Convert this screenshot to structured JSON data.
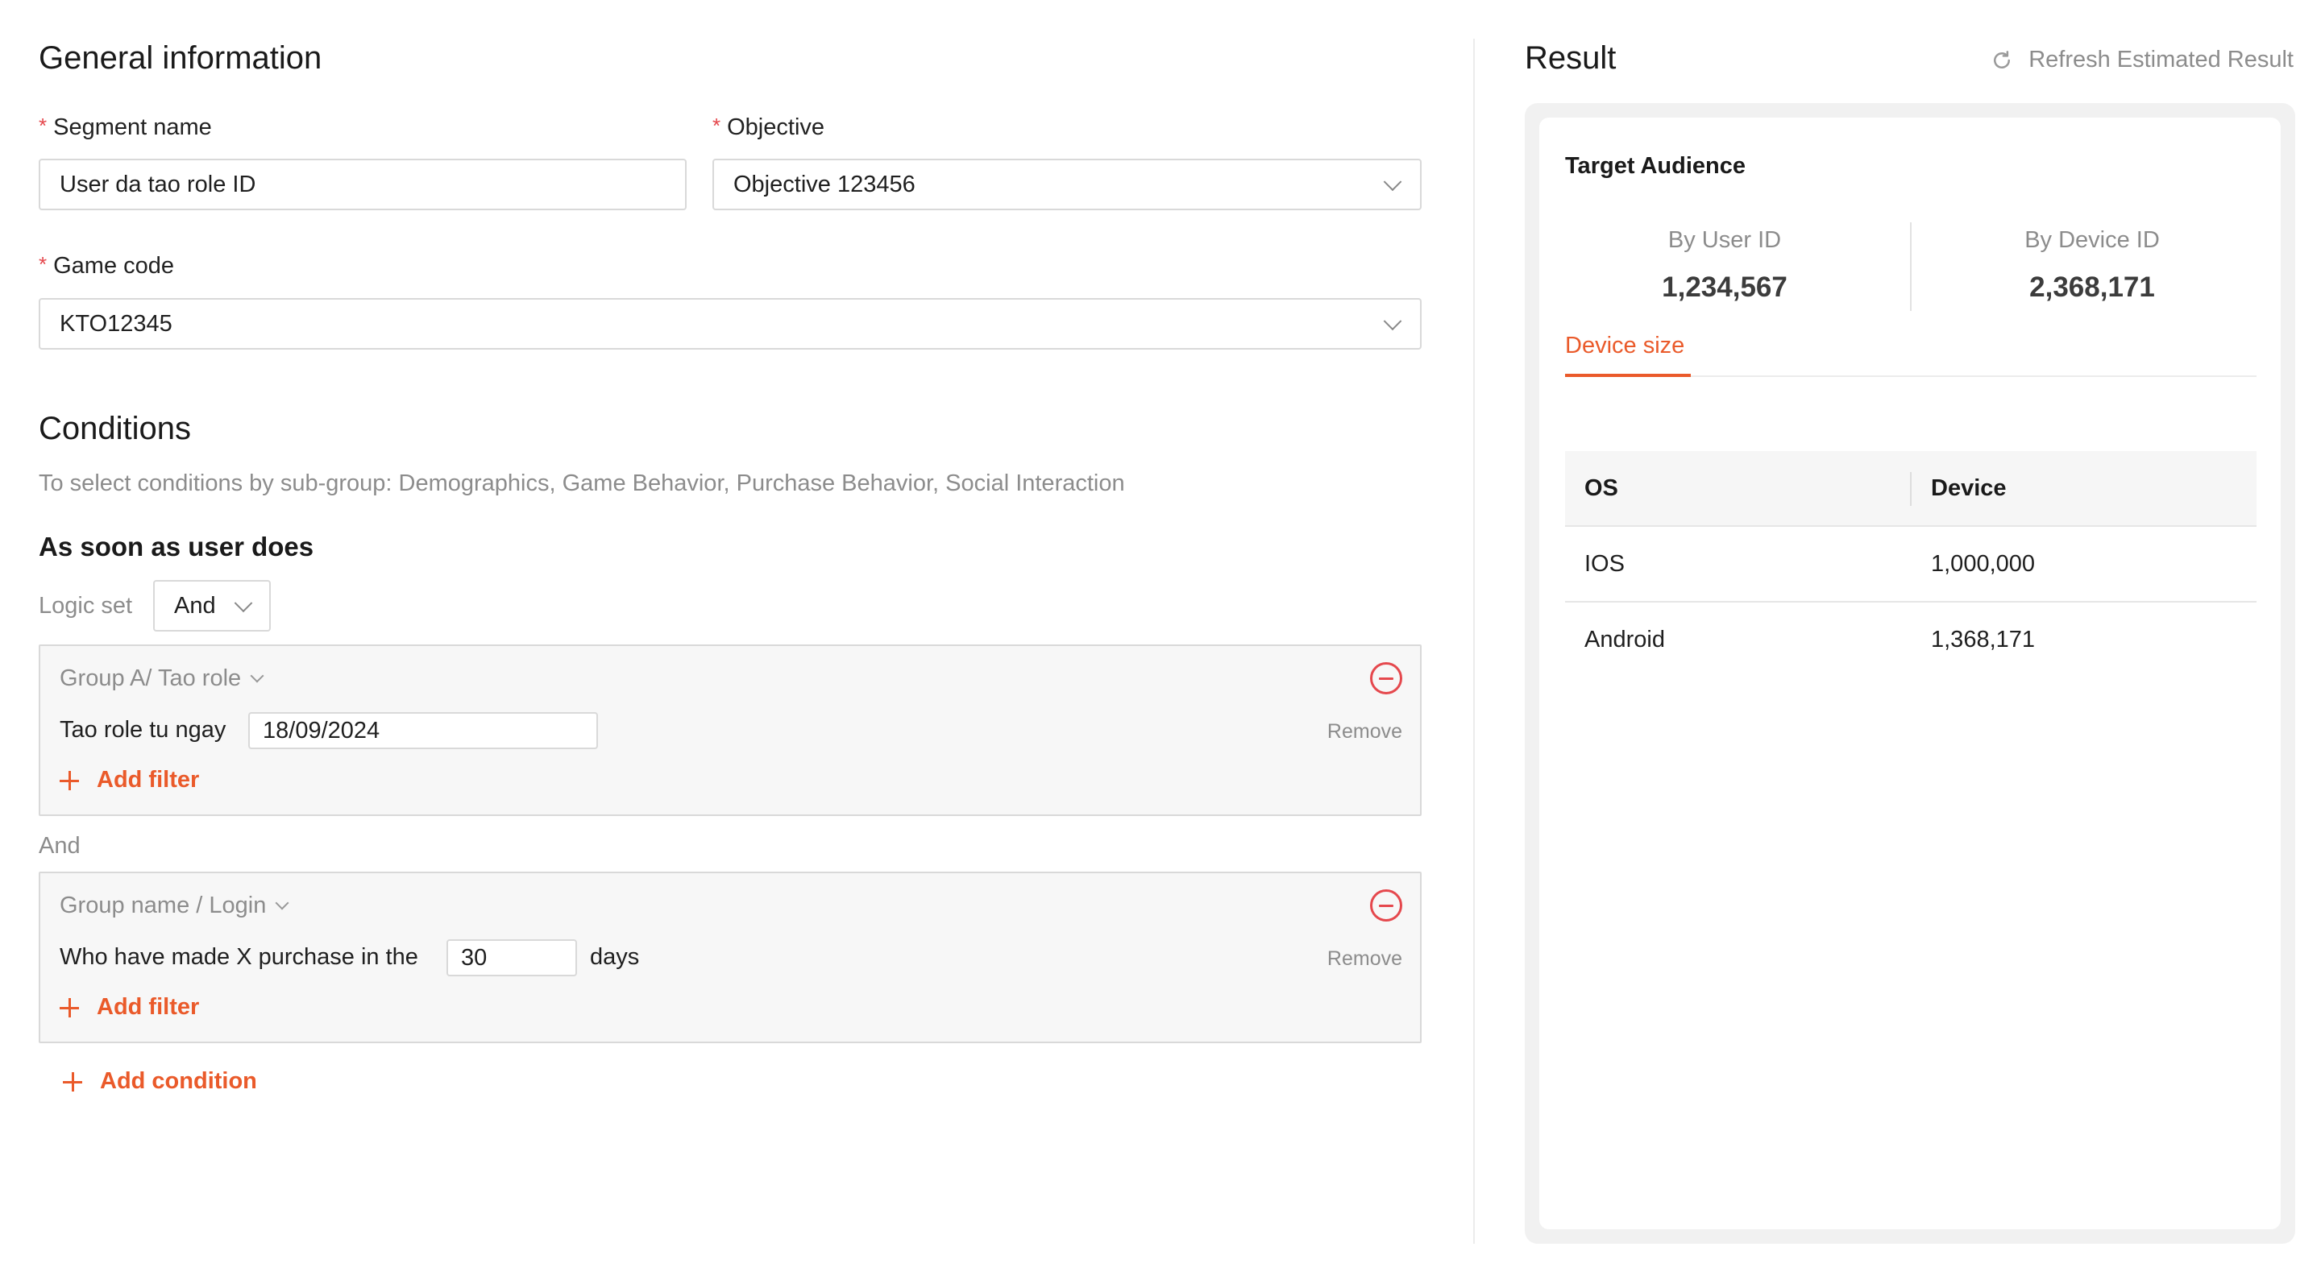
{
  "general": {
    "title": "General information",
    "segment_name_label": "Segment name",
    "segment_name_value": "User da tao role ID",
    "objective_label": "Objective",
    "objective_value": "Objective 123456",
    "game_code_label": "Game code",
    "game_code_value": "KTO12345"
  },
  "conditions": {
    "title": "Conditions",
    "subtitle": "To select conditions by sub-group: Demographics, Game Behavior, Purchase Behavior, Social Interaction",
    "section_title": "As soon as user does",
    "logic_label": "Logic set",
    "logic_value": "And",
    "between_label": "And",
    "groups": [
      {
        "name": "Group A/ Tao role",
        "filter_label": "Tao role tu ngay",
        "filter_value": "18/09/2024",
        "filter_suffix": "",
        "remove_label": "Remove",
        "add_filter_label": "Add filter"
      },
      {
        "name": "Group name / Login",
        "filter_label": "Who have made X purchase in the",
        "filter_value": "30",
        "filter_suffix": "days",
        "remove_label": "Remove",
        "add_filter_label": "Add filter"
      }
    ],
    "add_condition_label": "Add condition"
  },
  "result": {
    "title": "Result",
    "refresh_label": "Refresh Estimated Result",
    "card_title": "Target Audience",
    "by_user_label": "By User ID",
    "by_user_value": "1,234,567",
    "by_device_label": "By Device ID",
    "by_device_value": "2,368,171",
    "tab_label": "Device size",
    "table": {
      "headers": [
        "OS",
        "Device"
      ],
      "rows": [
        [
          "IOS",
          "1,000,000"
        ],
        [
          "Android",
          "1,368,171"
        ]
      ]
    }
  },
  "colors": {
    "accent": "#ea5a2a",
    "danger": "#e5484d",
    "border": "#d9d9d9"
  },
  "icons": [
    "chevron-down-icon",
    "minus-circle-icon",
    "plus-icon",
    "refresh-icon"
  ]
}
